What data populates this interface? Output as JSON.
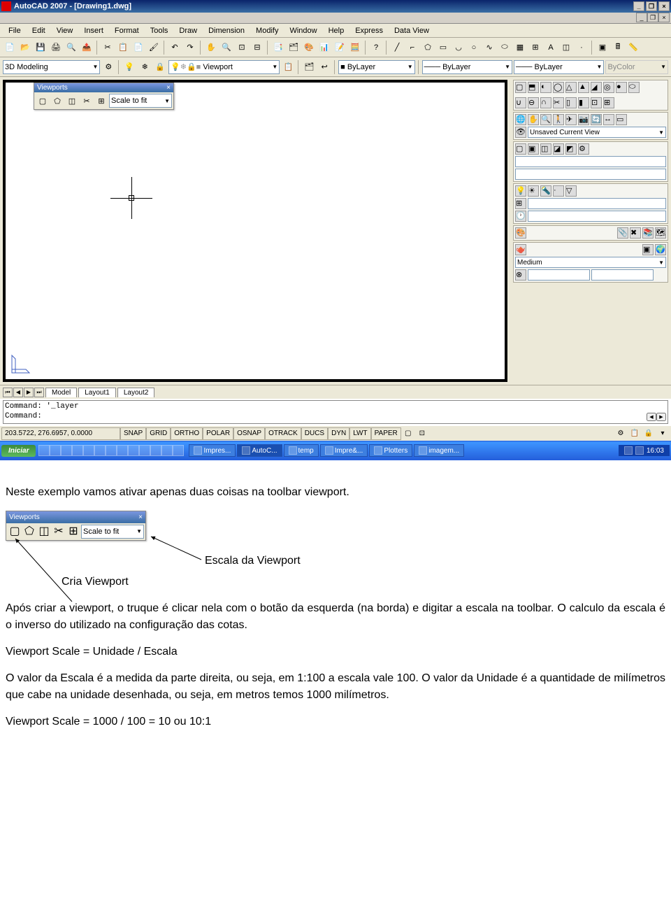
{
  "title": "AutoCAD 2007 - [Drawing1.dwg]",
  "menu": [
    "File",
    "Edit",
    "View",
    "Insert",
    "Format",
    "Tools",
    "Draw",
    "Dimension",
    "Modify",
    "Window",
    "Help",
    "Express",
    "Data View"
  ],
  "workspace_combo": "3D Modeling",
  "layer_combo": "Viewport",
  "linetype_combo": "ByLayer",
  "lineweight_combo": "ByLayer",
  "plotstyle_combo": "ByLayer",
  "color_combo": "ByColor",
  "viewports_toolbar": {
    "title": "Viewports",
    "scale": "Scale to fit"
  },
  "right_panel": {
    "view_combo": "Unsaved Current View",
    "visual_style": "Medium"
  },
  "tabs": [
    "Model",
    "Layout1",
    "Layout2"
  ],
  "command": {
    "line1": "Command: '_layer",
    "line2": "Command:"
  },
  "status": {
    "coords": "203.5722, 276.6957, 0.0000",
    "toggles": [
      "SNAP",
      "GRID",
      "ORTHO",
      "POLAR",
      "OSNAP",
      "OTRACK",
      "DUCS",
      "DYN",
      "LWT",
      "PAPER"
    ]
  },
  "taskbar": {
    "start": "Iniciar",
    "items": [
      "Impres...",
      "AutoC...",
      "temp",
      "Impre&...",
      "Plotters",
      "imagem..."
    ],
    "clock": "16:03"
  },
  "doc": {
    "p1": "Neste exemplo vamos ativar apenas duas coisas na toolbar viewport.",
    "label_escala": "Escala da Viewport",
    "label_cria": "Cria Viewport",
    "p2": "Após criar a viewport, o truque é clicar nela com o botão da esquerda (na borda) e digitar a escala na toolbar. O calculo da escala é o inverso do utilizado na configuração das cotas.",
    "p3": "Viewport Scale = Unidade / Escala",
    "p4": "O valor da Escala é a medida da parte direita, ou seja, em 1:100 a escala vale 100. O valor da Unidade é a quantidade de milímetros que cabe na unidade desenhada, ou seja, em metros temos 1000 milímetros.",
    "p5": "Viewport Scale = 1000 / 100 = 10 ou 10:1"
  }
}
